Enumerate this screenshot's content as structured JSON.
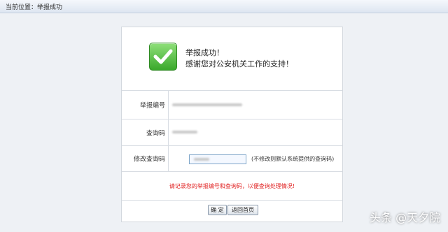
{
  "breadcrumb": {
    "text": "当前位置：举报成功"
  },
  "success": {
    "line1": "举报成功！",
    "line2": "感谢您对公安机关工作的支持！"
  },
  "fields": {
    "report_number_label": "举报编号",
    "query_code_label": "查询码",
    "modify_code_label": "修改查询码",
    "modify_code_hint": "(不修改则默认系统提供的查询码)"
  },
  "notice": "请记录您的举报编号和查询码，以便查询处理情况!",
  "buttons": {
    "confirm": "确 定",
    "back": "返回首页"
  },
  "watermark": "头条 @天夕院",
  "colors": {
    "notice": "#e02020",
    "success_icon": "#3aa82b"
  }
}
